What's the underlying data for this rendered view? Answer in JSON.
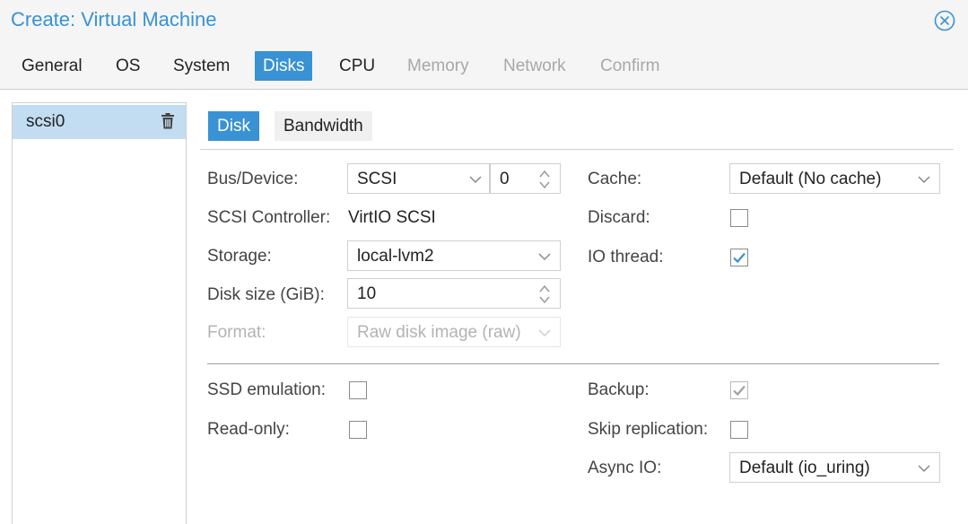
{
  "window": {
    "title": "Create: Virtual Machine"
  },
  "tabs": [
    {
      "label": "General",
      "state": "normal"
    },
    {
      "label": "OS",
      "state": "normal"
    },
    {
      "label": "System",
      "state": "normal"
    },
    {
      "label": "Disks",
      "state": "active"
    },
    {
      "label": "CPU",
      "state": "normal"
    },
    {
      "label": "Memory",
      "state": "disabled"
    },
    {
      "label": "Network",
      "state": "disabled"
    },
    {
      "label": "Confirm",
      "state": "disabled"
    }
  ],
  "disk_list": {
    "items": [
      {
        "label": "scsi0",
        "selected": true
      }
    ]
  },
  "subtabs": [
    {
      "label": "Disk",
      "state": "active"
    },
    {
      "label": "Bandwidth",
      "state": "inactive"
    }
  ],
  "form": {
    "bus_device": {
      "label": "Bus/Device:",
      "bus": "SCSI",
      "index": "0"
    },
    "scsi_controller": {
      "label": "SCSI Controller:",
      "value": "VirtIO SCSI"
    },
    "storage": {
      "label": "Storage:",
      "value": "local-lvm2"
    },
    "disk_size": {
      "label": "Disk size (GiB):",
      "value": "10"
    },
    "format": {
      "label": "Format:",
      "value": "Raw disk image (raw)",
      "disabled": true
    },
    "cache": {
      "label": "Cache:",
      "value": "Default (No cache)"
    },
    "discard": {
      "label": "Discard:",
      "checked": false
    },
    "io_thread": {
      "label": "IO thread:",
      "checked": true
    },
    "ssd_emulation": {
      "label": "SSD emulation:",
      "checked": false
    },
    "read_only": {
      "label": "Read-only:",
      "checked": false
    },
    "backup": {
      "label": "Backup:",
      "checked": true,
      "disabled": true
    },
    "skip_replication": {
      "label": "Skip replication:",
      "checked": false
    },
    "async_io": {
      "label": "Async IO:",
      "value": "Default (io_uring)"
    }
  },
  "colors": {
    "accent": "#3892d4",
    "selected_row": "#c2ddf2",
    "disabled_text": "#a8a8a8"
  },
  "icons": {
    "close": "close-circle-icon",
    "delete": "trash-icon",
    "dropdown": "chevron-down-icon",
    "spinner": "spinner-arrows-icon",
    "check": "check-icon"
  }
}
